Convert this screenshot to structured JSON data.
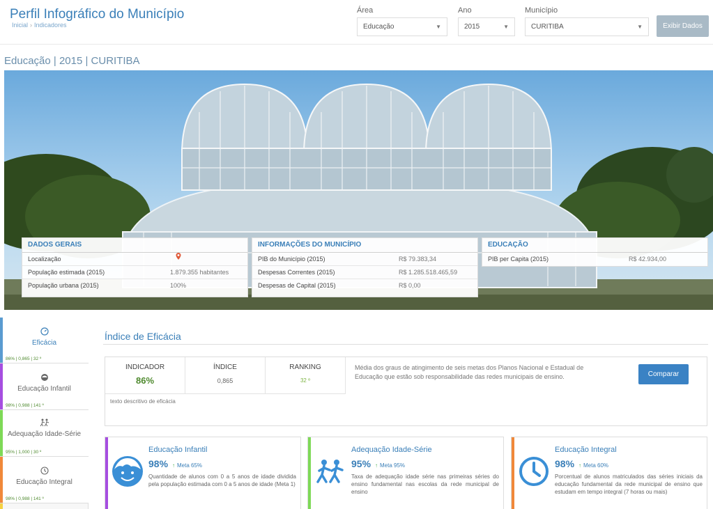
{
  "header": {
    "app_title": "Perfil Infográfico do Município",
    "breadcrumb": [
      "Inicial",
      "Indicadores"
    ],
    "area_label": "Área",
    "area_value": "Educação",
    "ano_label": "Ano",
    "ano_value": "2015",
    "municipio_label": "Município",
    "municipio_value": "CURITIBA",
    "exibir_button": "Exibir Dados"
  },
  "page_subtitle": "Educação | 2015 | CURITIBA",
  "dados_gerais": {
    "title": "DADOS GERAIS",
    "rows": [
      {
        "label": "Localização",
        "value": ""
      },
      {
        "label": "População estimada (2015)",
        "value": "1.879.355 habitantes"
      },
      {
        "label": "População urbana (2015)",
        "value": "100%"
      }
    ]
  },
  "informacoes": {
    "title": "INFORMAÇÕES DO MUNICÍPIO",
    "rows": [
      {
        "label": "PIB do Município (2015)",
        "value": "R$ 79.383,34"
      },
      {
        "label": "Despesas Correntes (2015)",
        "value": "R$ 1.285.518.465,59"
      },
      {
        "label": "Despesas de Capital (2015)",
        "value": "R$ 0,00"
      }
    ]
  },
  "educacao_card": {
    "title": "EDUCAÇÃO",
    "rows": [
      {
        "label": "PIB per Capita (2015)",
        "value": "R$ 42.934,00"
      }
    ]
  },
  "sidebar": {
    "items": [
      {
        "label": "Eficácia",
        "stat": "86% | 0,865 | 32 º",
        "color": "#3a7fb8",
        "icon": "gauge-icon"
      },
      {
        "label": "Educação Infantil",
        "stat": "98% | 0,988 | 141 º",
        "color": "#a64ee0",
        "icon": "child-face-icon"
      },
      {
        "label": "Adequação Idade-Série",
        "stat": "95% | 1,000 | 30 º",
        "color": "#7ed957",
        "icon": "running-kids-icon"
      },
      {
        "label": "Educação Integral",
        "stat": "98% | 0,988 | 141 º",
        "color": "#f0883a",
        "icon": "clock-icon"
      }
    ]
  },
  "main": {
    "section_title": "Índice de Eficácia",
    "indicador_label": "INDICADOR",
    "indicador_value": "86%",
    "indice_label": "ÍNDICE",
    "indice_value": "0,865",
    "ranking_label": "RANKING",
    "ranking_value": "32 º",
    "description": "Média dos graus de atingimento de seis metas dos Planos Nacional e Estadual de Educação que estão sob responsabilidade das redes municipais de ensino.",
    "compare_button": "Comparar",
    "extra_text": "texto descritivo de eficácia"
  },
  "cards": [
    {
      "title": "Educação Infantil",
      "pct": "98%",
      "meta": "Meta 65%",
      "desc": "Quantidade de alunos com 0 a 5 anos de idade dividida pela população estimada com 0 a 5 anos de idade (Meta 1)",
      "color": "#a64ee0",
      "icon": "child-face-icon"
    },
    {
      "title": "Adequação Idade-Série",
      "pct": "95%",
      "meta": "Meta 95%",
      "desc": "Taxa de adequação idade série nas primeiras séries do ensino fundamental nas escolas da rede municipal de ensino",
      "color": "#7ed957",
      "icon": "running-kids-icon"
    },
    {
      "title": "Educação Integral",
      "pct": "98%",
      "meta": "Meta 60%",
      "desc": "Porcentual de alunos matriculados das séries iniciais da educação fundamental da rede municipal de ensino que estudam em tempo integral (7 horas ou mais)",
      "color": "#f0883a",
      "icon": "clock-icon"
    }
  ],
  "colors": {
    "accent": "#3a7fb8",
    "success": "#4f8a2f",
    "button_primary": "#3a82c4",
    "button_disabled": "#a9bac6"
  }
}
